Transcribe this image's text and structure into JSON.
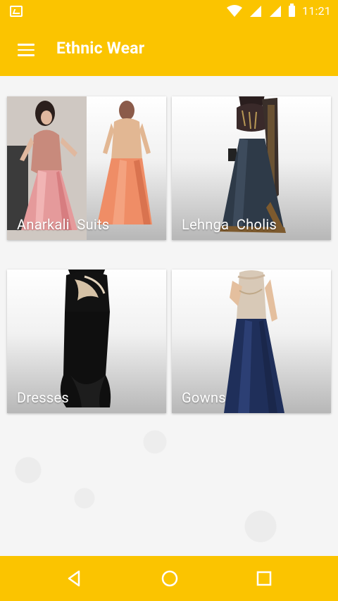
{
  "status_bar": {
    "time": "11:21"
  },
  "toolbar": {
    "title": "Ethnic Wear"
  },
  "categories": [
    {
      "label": "Anarkali  Suits"
    },
    {
      "label": "Lehnga  Cholis"
    },
    {
      "label": "Dresses"
    },
    {
      "label": "Gowns"
    }
  ],
  "colors": {
    "accent": "#fbc400",
    "background": "#f5f5f5"
  },
  "icons": {
    "menu": "hamburger-menu-icon",
    "back": "nav-back-icon",
    "home": "nav-home-icon",
    "recents": "nav-recents-icon"
  }
}
